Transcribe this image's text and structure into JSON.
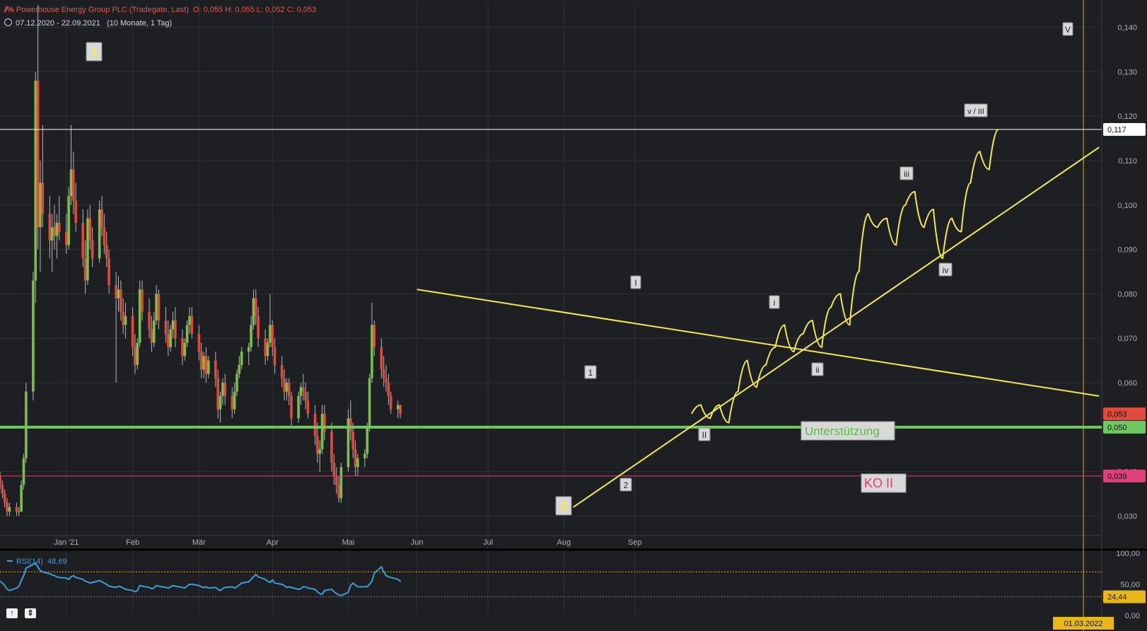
{
  "header": {
    "instrument": "Powerhouse Energy Group PLC (Tradegate, Last)",
    "ohlc": "O: 0,055  H: 0,055  L: 0,052  C: 0,053",
    "range": "07.12.2020 - 22.09.2021",
    "period": "(10 Monate, 1 Tag)"
  },
  "rsi_header": {
    "label": "RSI(14)",
    "value": "48,69"
  },
  "colors": {
    "background": "#1e1f23",
    "up": "#7cc04b",
    "down": "#e04a3a",
    "wick": "#b8b8b8",
    "yellow": "#f2e94e",
    "support": "#6fc860",
    "ko": "#e0407a",
    "rsi": "#3a9fd6",
    "white": "#ffffff"
  },
  "nav": {
    "up_icon": "arrow-up-icon",
    "fit_icon": "fit-vertical-icon"
  },
  "chart_data": {
    "type": "candlestick",
    "price_axis": {
      "ylim": [
        0.0245,
        0.1455
      ],
      "ticks": [
        "0,030",
        "0,040",
        "0,050",
        "0,060",
        "0,070",
        "0,080",
        "0,090",
        "0,100",
        "0,110",
        "0,120",
        "0,130",
        "0,140"
      ],
      "tick_values": [
        0.03,
        0.04,
        0.05,
        0.06,
        0.07,
        0.08,
        0.09,
        0.1,
        0.11,
        0.12,
        0.13,
        0.14
      ]
    },
    "time_axis": {
      "labels": [
        "Jan '21",
        "Feb",
        "Mär",
        "Apr",
        "Mai",
        "Jun",
        "Jul",
        "Aug",
        "Sep"
      ],
      "label_dates": [
        "2021-01-04",
        "2021-02-01",
        "2021-03-01",
        "2021-04-01",
        "2021-05-03",
        "2021-06-01",
        "2021-07-01",
        "2021-08-02",
        "2021-09-01"
      ],
      "start": "2020-12-07",
      "end_marker": "2022-03-01",
      "end_marker_label": "01.03.2022"
    },
    "candles_ohlc": [
      [
        0.039,
        0.04,
        0.036,
        0.037
      ],
      [
        0.037,
        0.038,
        0.034,
        0.035
      ],
      [
        0.035,
        0.036,
        0.032,
        0.033
      ],
      [
        0.033,
        0.034,
        0.03,
        0.031
      ],
      [
        0.031,
        0.033,
        0.03,
        0.032
      ],
      [
        0.032,
        0.033,
        0.03,
        0.031
      ],
      [
        0.031,
        0.032,
        0.03,
        0.031
      ],
      [
        0.031,
        0.038,
        0.031,
        0.037
      ],
      [
        0.037,
        0.044,
        0.036,
        0.043
      ],
      [
        0.043,
        0.06,
        0.042,
        0.058
      ],
      [
        0.058,
        0.085,
        0.056,
        0.083
      ],
      [
        0.083,
        0.13,
        0.078,
        0.128
      ],
      [
        0.128,
        0.145,
        0.09,
        0.095
      ],
      [
        0.095,
        0.11,
        0.085,
        0.105
      ],
      [
        0.105,
        0.118,
        0.095,
        0.098
      ],
      [
        0.098,
        0.102,
        0.088,
        0.092
      ],
      [
        0.092,
        0.098,
        0.085,
        0.095
      ],
      [
        0.095,
        0.1,
        0.09,
        0.093
      ],
      [
        0.093,
        0.098,
        0.088,
        0.096
      ],
      [
        0.096,
        0.102,
        0.092,
        0.094
      ],
      [
        0.094,
        0.098,
        0.089,
        0.091
      ],
      [
        0.091,
        0.104,
        0.09,
        0.102
      ],
      [
        0.102,
        0.118,
        0.1,
        0.108
      ],
      [
        0.108,
        0.112,
        0.098,
        0.101
      ],
      [
        0.101,
        0.105,
        0.094,
        0.096
      ],
      [
        0.096,
        0.099,
        0.086,
        0.088
      ],
      [
        0.088,
        0.092,
        0.08,
        0.083
      ],
      [
        0.083,
        0.099,
        0.082,
        0.097
      ],
      [
        0.097,
        0.1,
        0.09,
        0.092
      ],
      [
        0.092,
        0.095,
        0.086,
        0.088
      ],
      [
        0.088,
        0.101,
        0.087,
        0.099
      ],
      [
        0.099,
        0.102,
        0.093,
        0.095
      ],
      [
        0.095,
        0.098,
        0.089,
        0.091
      ],
      [
        0.091,
        0.094,
        0.086,
        0.088
      ],
      [
        0.088,
        0.09,
        0.08,
        0.082
      ],
      [
        0.082,
        0.085,
        0.06,
        0.079
      ],
      [
        0.079,
        0.084,
        0.076,
        0.081
      ],
      [
        0.081,
        0.083,
        0.074,
        0.076
      ],
      [
        0.076,
        0.079,
        0.071,
        0.073
      ],
      [
        0.073,
        0.078,
        0.07,
        0.075
      ],
      [
        0.075,
        0.077,
        0.066,
        0.068
      ],
      [
        0.068,
        0.071,
        0.062,
        0.064
      ],
      [
        0.064,
        0.07,
        0.063,
        0.069
      ],
      [
        0.069,
        0.083,
        0.068,
        0.081
      ],
      [
        0.081,
        0.083,
        0.074,
        0.076
      ],
      [
        0.076,
        0.079,
        0.07,
        0.072
      ],
      [
        0.072,
        0.075,
        0.067,
        0.069
      ],
      [
        0.069,
        0.076,
        0.068,
        0.074
      ],
      [
        0.074,
        0.082,
        0.073,
        0.08
      ],
      [
        0.08,
        0.081,
        0.072,
        0.074
      ],
      [
        0.074,
        0.077,
        0.069,
        0.071
      ],
      [
        0.071,
        0.074,
        0.066,
        0.068
      ],
      [
        0.068,
        0.073,
        0.067,
        0.072
      ],
      [
        0.072,
        0.076,
        0.07,
        0.074
      ],
      [
        0.074,
        0.077,
        0.068,
        0.07
      ],
      [
        0.07,
        0.072,
        0.064,
        0.066
      ],
      [
        0.066,
        0.07,
        0.065,
        0.069
      ],
      [
        0.069,
        0.074,
        0.068,
        0.073
      ],
      [
        0.073,
        0.077,
        0.071,
        0.075
      ],
      [
        0.075,
        0.077,
        0.07,
        0.071
      ],
      [
        0.071,
        0.073,
        0.065,
        0.067
      ],
      [
        0.067,
        0.069,
        0.061,
        0.063
      ],
      [
        0.063,
        0.067,
        0.061,
        0.066
      ],
      [
        0.066,
        0.068,
        0.06,
        0.062
      ],
      [
        0.062,
        0.066,
        0.061,
        0.065
      ],
      [
        0.065,
        0.067,
        0.059,
        0.061
      ],
      [
        0.061,
        0.063,
        0.052,
        0.054
      ],
      [
        0.054,
        0.058,
        0.051,
        0.057
      ],
      [
        0.057,
        0.061,
        0.055,
        0.06
      ],
      [
        0.06,
        0.062,
        0.055,
        0.057
      ],
      [
        0.057,
        0.059,
        0.052,
        0.054
      ],
      [
        0.054,
        0.06,
        0.053,
        0.058
      ],
      [
        0.058,
        0.063,
        0.057,
        0.062
      ],
      [
        0.062,
        0.066,
        0.061,
        0.064
      ],
      [
        0.064,
        0.068,
        0.063,
        0.067
      ],
      [
        0.067,
        0.069,
        0.064,
        0.068
      ],
      [
        0.068,
        0.075,
        0.067,
        0.073
      ],
      [
        0.073,
        0.081,
        0.072,
        0.079
      ],
      [
        0.079,
        0.081,
        0.073,
        0.075
      ],
      [
        0.075,
        0.077,
        0.068,
        0.07
      ],
      [
        0.07,
        0.072,
        0.064,
        0.066
      ],
      [
        0.066,
        0.07,
        0.065,
        0.069
      ],
      [
        0.069,
        0.08,
        0.068,
        0.073
      ],
      [
        0.073,
        0.074,
        0.066,
        0.068
      ],
      [
        0.068,
        0.07,
        0.062,
        0.064
      ],
      [
        0.064,
        0.066,
        0.059,
        0.061
      ],
      [
        0.061,
        0.063,
        0.056,
        0.058
      ],
      [
        0.058,
        0.061,
        0.056,
        0.06
      ],
      [
        0.06,
        0.061,
        0.055,
        0.057
      ],
      [
        0.057,
        0.058,
        0.05,
        0.052
      ],
      [
        0.052,
        0.058,
        0.051,
        0.057
      ],
      [
        0.057,
        0.06,
        0.055,
        0.059
      ],
      [
        0.059,
        0.062,
        0.056,
        0.058
      ],
      [
        0.058,
        0.06,
        0.054,
        0.056
      ],
      [
        0.056,
        0.058,
        0.052,
        0.053
      ],
      [
        0.053,
        0.055,
        0.046,
        0.048
      ],
      [
        0.048,
        0.051,
        0.042,
        0.044
      ],
      [
        0.044,
        0.047,
        0.04,
        0.045
      ],
      [
        0.045,
        0.055,
        0.044,
        0.053
      ],
      [
        0.053,
        0.055,
        0.047,
        0.049
      ],
      [
        0.049,
        0.051,
        0.04,
        0.042
      ],
      [
        0.042,
        0.044,
        0.037,
        0.039
      ],
      [
        0.039,
        0.041,
        0.035,
        0.037
      ],
      [
        0.037,
        0.039,
        0.033,
        0.034
      ],
      [
        0.034,
        0.042,
        0.033,
        0.041
      ],
      [
        0.041,
        0.054,
        0.04,
        0.052
      ],
      [
        0.052,
        0.056,
        0.047,
        0.049
      ],
      [
        0.049,
        0.051,
        0.043,
        0.045
      ],
      [
        0.045,
        0.047,
        0.039,
        0.041
      ],
      [
        0.041,
        0.044,
        0.039,
        0.043
      ],
      [
        0.043,
        0.045,
        0.041,
        0.044
      ],
      [
        0.044,
        0.051,
        0.043,
        0.05
      ],
      [
        0.05,
        0.062,
        0.049,
        0.061
      ],
      [
        0.061,
        0.078,
        0.06,
        0.073
      ],
      [
        0.073,
        0.074,
        0.066,
        0.068
      ],
      [
        0.068,
        0.07,
        0.061,
        0.063
      ],
      [
        0.063,
        0.066,
        0.059,
        0.061
      ],
      [
        0.061,
        0.064,
        0.058,
        0.06
      ],
      [
        0.06,
        0.062,
        0.055,
        0.057
      ],
      [
        0.057,
        0.058,
        0.053,
        0.054
      ],
      [
        0.054,
        0.056,
        0.052,
        0.055
      ],
      [
        0.055,
        0.055,
        0.052,
        0.053
      ]
    ],
    "horizontal_levels": [
      {
        "value": 0.117,
        "label": "0,117",
        "color": "#ffffff"
      },
      {
        "value": 0.05,
        "label": "0,050",
        "color": "#6fc860",
        "text": "Unterstützung"
      },
      {
        "value": 0.039,
        "label": "0,039",
        "color": "#e0407a",
        "text": "KO II"
      }
    ],
    "last_price": {
      "value": 0.053,
      "label": "0,053"
    },
    "trendlines": [
      {
        "name": "resistance",
        "points": [
          [
            "2021-06-01",
            0.081
          ],
          [
            "2022-03-16",
            0.057
          ]
        ]
      },
      {
        "name": "support",
        "points": [
          [
            "2021-08-06",
            0.032
          ],
          [
            "2022-03-16",
            0.113
          ]
        ]
      }
    ],
    "projection_path": [
      0.053,
      0.055,
      0.052,
      0.055,
      0.051,
      0.058,
      0.065,
      0.059,
      0.064,
      0.068,
      0.073,
      0.067,
      0.071,
      0.074,
      0.068,
      0.077,
      0.08,
      0.073,
      0.085,
      0.098,
      0.095,
      0.097,
      0.091,
      0.1,
      0.103,
      0.095,
      0.099,
      0.088,
      0.097,
      0.094,
      0.105,
      0.112,
      0.108,
      0.117
    ],
    "wave_labels": [
      {
        "text": "1",
        "style": "big"
      },
      {
        "text": "2",
        "style": "big"
      },
      {
        "text": "1",
        "style": "small"
      },
      {
        "text": "2",
        "style": "small"
      },
      {
        "text": "I",
        "style": "small"
      },
      {
        "text": "II",
        "style": "small"
      },
      {
        "text": "i",
        "style": "small"
      },
      {
        "text": "ii",
        "style": "small"
      },
      {
        "text": "iii",
        "style": "small"
      },
      {
        "text": "iv",
        "style": "small"
      },
      {
        "text": "v / III",
        "style": "small"
      },
      {
        "text": "V",
        "style": "small"
      }
    ],
    "rsi": {
      "ticks": [
        "0,00",
        "50,00",
        "100,00"
      ],
      "tick_values": [
        0,
        50,
        100
      ],
      "upper": 70,
      "lower": 30,
      "last_value_label": "24,44",
      "values": [
        55,
        52,
        48,
        42,
        40,
        44,
        47,
        56,
        64,
        76,
        82,
        84,
        78,
        72,
        70,
        67,
        65,
        64,
        62,
        61,
        60,
        58,
        62,
        64,
        61,
        58,
        55,
        54,
        52,
        53,
        56,
        54,
        52,
        50,
        47,
        45,
        47,
        46,
        44,
        42,
        40,
        38,
        40,
        48,
        47,
        45,
        43,
        44,
        48,
        47,
        45,
        44,
        46,
        48,
        47,
        45,
        44,
        47,
        50,
        50,
        48,
        46,
        45,
        46,
        44,
        45,
        42,
        40,
        43,
        45,
        46,
        44,
        46,
        49,
        52,
        54,
        58,
        62,
        66,
        62,
        58,
        55,
        53,
        57,
        52,
        50,
        48,
        45,
        46,
        45,
        42,
        43,
        46,
        46,
        44,
        42,
        38,
        35,
        34,
        40,
        42,
        38,
        35,
        33,
        32,
        37,
        48,
        52,
        49,
        46,
        46,
        46,
        50,
        55,
        68,
        78,
        70,
        64,
        62,
        61,
        58,
        55,
        54,
        55
      ]
    }
  }
}
